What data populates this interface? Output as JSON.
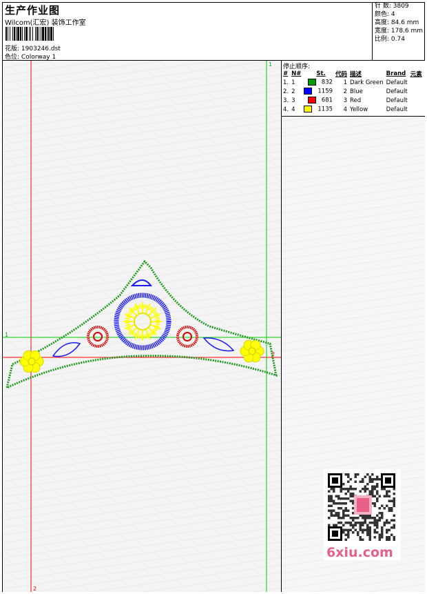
{
  "header": {
    "title": "生产作业图",
    "studio": "Wilcom(汇宏) 装饰工作室",
    "design_label": "花版:",
    "design_value": "1903246.dst",
    "colorway_label": "色位:",
    "colorway_value": "Colorway 1"
  },
  "stats": {
    "stitches": "针 数: 3809",
    "colors": "颜色: 4",
    "height": "高度: 84.6 mm",
    "width": "宽度: 178.6 mm",
    "ratio": "比例: 0.74"
  },
  "stop_sequence": {
    "title": "停止顺序:",
    "headers": [
      "#",
      "N#",
      "St.",
      "代码",
      "描述",
      "Brand",
      "元素"
    ],
    "rows": [
      {
        "num": "1.",
        "n": "1",
        "color": "#009900",
        "stitches": "832",
        "code": "1",
        "desc": "Dark Green",
        "brand": "Default"
      },
      {
        "num": "2.",
        "n": "2",
        "color": "#0000ff",
        "stitches": "1159",
        "code": "2",
        "desc": "Blue",
        "brand": "Default"
      },
      {
        "num": "3.",
        "n": "3",
        "color": "#ff0000",
        "stitches": "681",
        "code": "3",
        "desc": "Red",
        "brand": "Default"
      },
      {
        "num": "4.",
        "n": "4",
        "color": "#ffff00",
        "stitches": "1135",
        "code": "4",
        "desc": "Yellow",
        "brand": "Default"
      }
    ]
  },
  "guides": {
    "marker_1": "1",
    "marker_2": "2"
  },
  "watermark": "6xiu.com"
}
